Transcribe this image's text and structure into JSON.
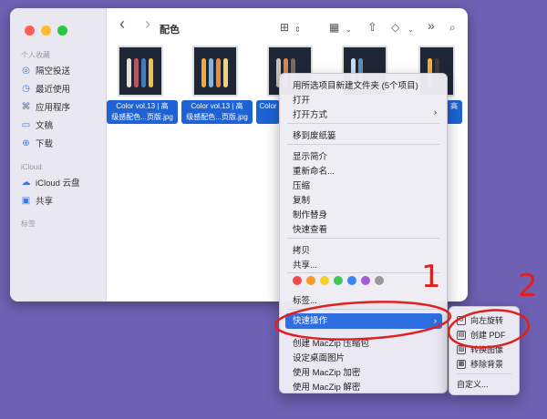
{
  "window": {
    "title": "配色",
    "sidebar": {
      "favorites_label": "个人收藏",
      "icloud_label": "iCloud",
      "tags_label": "标签",
      "items": [
        {
          "label": "隔空投送",
          "icon": "airdrop-icon"
        },
        {
          "label": "最近使用",
          "icon": "clock-icon"
        },
        {
          "label": "应用程序",
          "icon": "applications-icon"
        },
        {
          "label": "文稿",
          "icon": "document-icon"
        },
        {
          "label": "下载",
          "icon": "download-icon"
        },
        {
          "label": "iCloud 云盘",
          "icon": "cloud-icon"
        },
        {
          "label": "共享",
          "icon": "shared-folder-icon"
        }
      ]
    },
    "toolbar": {
      "back": "‹",
      "forward": "›",
      "more": "»"
    },
    "files": [
      {
        "label_line1": "Color vol.13 | 高",
        "label_line2": "级感配色...页版.jpg"
      },
      {
        "label_line1": "Color vol.13 | 高",
        "label_line2": "级感配色...页版.jpg"
      },
      {
        "label_line1": "Color",
        "label_line2": ""
      },
      {
        "label_line1": "",
        "label_line2": ""
      },
      {
        "label_line1": "高",
        "label_line2": ""
      }
    ]
  },
  "context_menu": {
    "items": [
      {
        "label": "用所选项目新建文件夹 (5个项目)"
      },
      {
        "label": "打开"
      },
      {
        "label": "打开方式",
        "submenu": "›"
      },
      {
        "label": "移到废纸篓"
      },
      {
        "label": "显示简介"
      },
      {
        "label": "重新命名..."
      },
      {
        "label": "压缩"
      },
      {
        "label": "复制"
      },
      {
        "label": "制作替身"
      },
      {
        "label": "快速查看"
      },
      {
        "label": "拷贝"
      },
      {
        "label": "共享..."
      },
      {
        "label": "标签..."
      }
    ],
    "highlighted": {
      "label": "快速操作",
      "submenu": "›"
    },
    "after_items": [
      {
        "label": "创建 MacZip 压缩包"
      },
      {
        "label": "设定桌面图片"
      },
      {
        "label": "使用 MacZip 加密"
      },
      {
        "label": "使用 MacZip 解密"
      }
    ],
    "tag_colors": [
      "#ef4b4b",
      "#f59a2a",
      "#f5cf2a",
      "#43c55a",
      "#3a86f0",
      "#a45bd6",
      "#9a9a9a"
    ]
  },
  "quick_actions_submenu": {
    "items": [
      {
        "label": "向左旋转",
        "icon": "rotate-left-icon"
      },
      {
        "label": "创建 PDF",
        "icon": "pdf-icon"
      },
      {
        "label": "转换图像",
        "icon": "convert-image-icon"
      },
      {
        "label": "移除背景",
        "icon": "remove-background-icon"
      }
    ],
    "customize": "自定义..."
  },
  "annotations": {
    "label_1": "1",
    "label_2": "2",
    "color": "#e02020"
  }
}
